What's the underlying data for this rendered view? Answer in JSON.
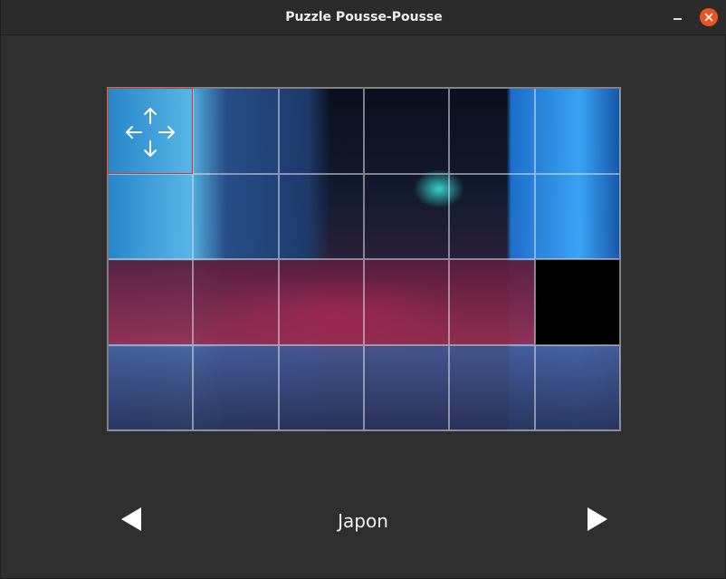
{
  "window": {
    "title": "Puzzle Pousse-Pousse"
  },
  "titlebar": {
    "minimize_icon": "minimize-icon",
    "close_icon": "close-icon",
    "close_color": "#e95420"
  },
  "puzzle": {
    "name": "Japon",
    "columns": 6,
    "rows": 4,
    "empty_tile": {
      "row": 2,
      "col": 5
    },
    "selected_tile": {
      "row": 0,
      "col": 0
    },
    "selected_color": "#d9362b",
    "move_icon": "move-arrows-icon"
  },
  "navigation": {
    "prev_icon": "triangle-left-icon",
    "next_icon": "triangle-right-icon"
  }
}
